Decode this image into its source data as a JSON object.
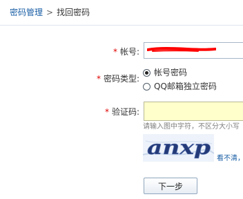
{
  "breadcrumb": {
    "parent": "密码管理",
    "separator": ">",
    "current": "找回密码"
  },
  "form": {
    "required_mark": "*",
    "account": {
      "label": "帐号:",
      "value": ""
    },
    "password_type": {
      "label": "密码类型:",
      "options": [
        {
          "label": "帐号密码",
          "checked": true
        },
        {
          "label": "QQ邮箱独立密码",
          "checked": false
        }
      ]
    },
    "verification_code": {
      "label": "验证码:",
      "value": "",
      "hint": "请输入图中字符，不区分大小写",
      "captcha_text": "anxp",
      "refresh_link": "看不清，换"
    },
    "next_button": "下一步"
  },
  "colors": {
    "link": "#1b5fa6",
    "required": "#e00000",
    "code_input_background": "#ffffcc",
    "redaction": "#ff0000"
  }
}
